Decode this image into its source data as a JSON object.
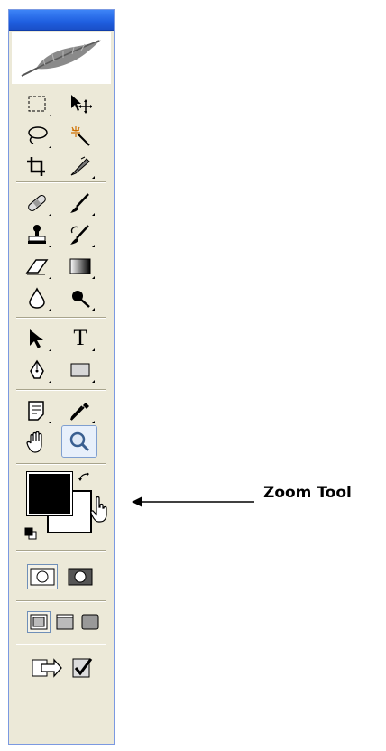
{
  "annotation": {
    "label": "Zoom Tool"
  },
  "tools": {
    "rows": [
      [
        "rectangular-marquee",
        "move"
      ],
      [
        "lasso",
        "magic-wand"
      ],
      [
        "crop",
        "slice"
      ],
      [
        "healing-brush",
        "brush"
      ],
      [
        "clone-stamp",
        "history-brush"
      ],
      [
        "eraser",
        "gradient"
      ],
      [
        "blur",
        "dodge"
      ],
      [
        "path-selection",
        "type"
      ],
      [
        "pen",
        "rectangle"
      ],
      [
        "notes",
        "eyedropper"
      ],
      [
        "hand",
        "zoom"
      ]
    ],
    "active": "zoom"
  },
  "colors": {
    "titlebar": "#2563e8",
    "palette_bg": "#ece9d8",
    "foreground": "#000000",
    "background": "#ffffff"
  },
  "type_glyph": "T"
}
